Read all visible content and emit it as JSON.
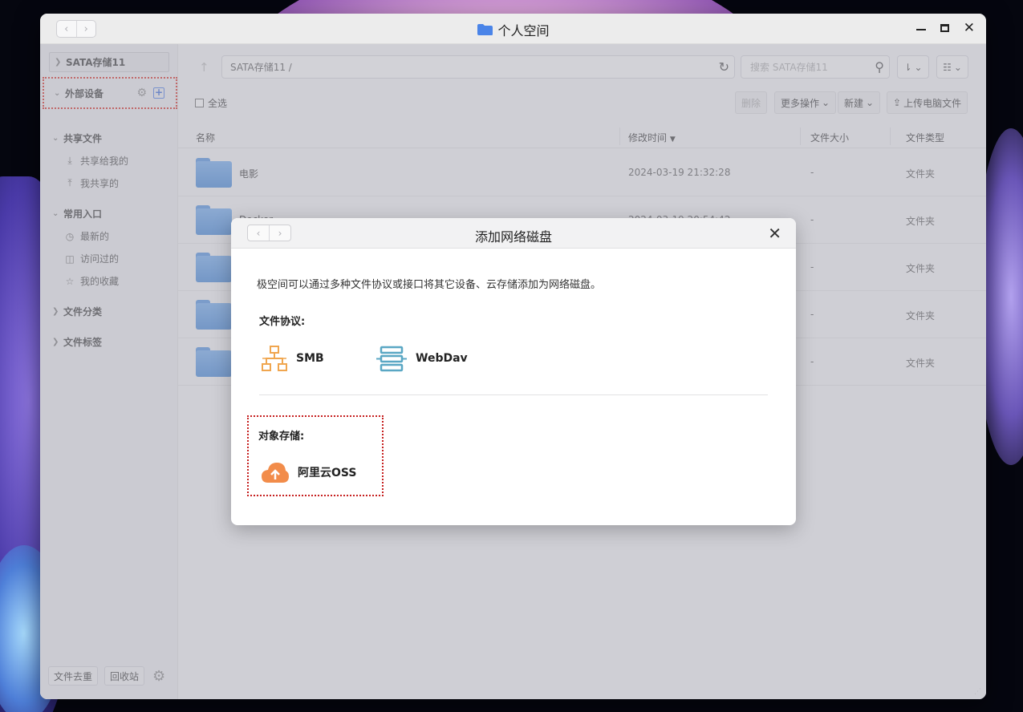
{
  "window": {
    "title": "个人空间",
    "nav_back": "‹",
    "nav_forward": "›"
  },
  "sidebar": {
    "storage_label": "SATA存储11",
    "external_label": "外部设备",
    "shared_section": "共享文件",
    "shared_items": [
      {
        "label": "共享给我的",
        "icon": "inbox-share-icon"
      },
      {
        "label": "我共享的",
        "icon": "outbox-share-icon"
      }
    ],
    "common_section": "常用入口",
    "common_items": [
      {
        "label": "最新的",
        "icon": "clock-icon"
      },
      {
        "label": "访问过的",
        "icon": "history-icon"
      },
      {
        "label": "我的收藏",
        "icon": "star-icon"
      }
    ],
    "category_section": "文件分类",
    "tag_section": "文件标签",
    "footer_dedup": "文件去重",
    "footer_recycle": "回收站"
  },
  "toolbar": {
    "path": "SATA存储11 /",
    "search_placeholder": "搜索 SATA存储11",
    "select_all": "全选",
    "delete": "删除",
    "more_actions": "更多操作",
    "new": "新建",
    "upload": "上传电脑文件"
  },
  "table": {
    "headers": {
      "name": "名称",
      "modified": "修改时间",
      "size": "文件大小",
      "type": "文件类型"
    },
    "rows": [
      {
        "name": "电影",
        "modified": "2024-03-19 21:32:28",
        "size": "-",
        "type": "文件夹"
      },
      {
        "name": "Docker",
        "modified": "2024-03-19 20:54:42",
        "size": "-",
        "type": "文件夹"
      },
      {
        "name": "",
        "modified": "",
        "size": "-",
        "type": "文件夹"
      },
      {
        "name": "",
        "modified": "",
        "size": "-",
        "type": "文件夹"
      },
      {
        "name": "",
        "modified": "",
        "size": "-",
        "type": "文件夹"
      }
    ]
  },
  "dialog": {
    "title": "添加网络磁盘",
    "description": "极空间可以通过多种文件协议或接口将其它设备、云存储添加为网络磁盘。",
    "protocols_label": "文件协议:",
    "protocols": [
      {
        "label": "SMB",
        "icon": "network-topology-icon"
      },
      {
        "label": "WebDav",
        "icon": "server-stack-icon"
      }
    ],
    "object_storage_label": "对象存储:",
    "object_storage": [
      {
        "label": "阿里云OSS",
        "icon": "cloud-upload-icon"
      }
    ]
  },
  "colors": {
    "accent": "#2e63d9",
    "folder": "#4d8fe0",
    "highlight_border": "#d6261f",
    "smb_icon": "#f0a64f",
    "webdav_icon": "#5aa7c4",
    "oss_icon": "#f28c4a"
  }
}
